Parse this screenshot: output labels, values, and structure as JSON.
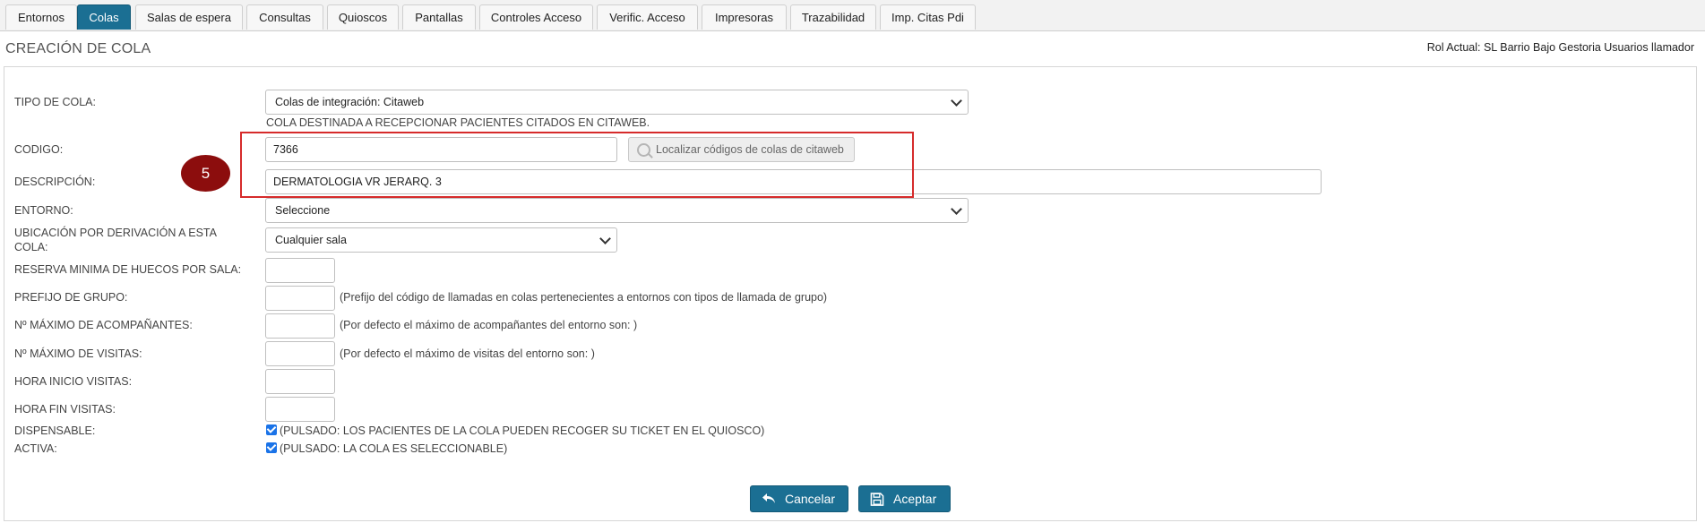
{
  "tabs": [
    {
      "label": "Entornos",
      "active": false
    },
    {
      "label": "Colas",
      "active": true
    },
    {
      "label": "Salas de espera",
      "active": false
    },
    {
      "label": "Consultas",
      "active": false
    },
    {
      "label": "Quioscos",
      "active": false
    },
    {
      "label": "Pantallas",
      "active": false
    },
    {
      "label": "Controles Acceso",
      "active": false
    },
    {
      "label": "Verific. Acceso",
      "active": false
    },
    {
      "label": "Impresoras",
      "active": false
    },
    {
      "label": "Trazabilidad",
      "active": false
    },
    {
      "label": "Imp. Citas Pdi",
      "active": false
    }
  ],
  "header": {
    "title": "CREACIÓN DE COLA",
    "role": "Rol Actual: SL Barrio Bajo Gestoria Usuarios llamador"
  },
  "form": {
    "tipo_label": "TIPO DE COLA:",
    "tipo_value": "Colas de integración: Citaweb",
    "tipo_desc": "COLA DESTINADA A RECEPCIONAR PACIENTES CITADOS EN CITAWEB.",
    "codigo_label": "CODIGO:",
    "codigo_value": "7366",
    "locate_label": "Localizar códigos de colas de citaweb",
    "descripcion_label": "DESCRIPCIÓN:",
    "descripcion_value": "DERMATOLOGIA VR JERARQ. 3",
    "entorno_label": "ENTORNO:",
    "entorno_value": "Seleccione",
    "ubicacion_label_1": "UBICACIÓN POR DERIVACIÓN A ESTA",
    "ubicacion_label_2": "COLA:",
    "ubicacion_value": "Cualquier sala",
    "reserva_label": "RESERVA MINIMA DE HUECOS POR SALA:",
    "prefijo_label": "PREFIJO DE GRUPO:",
    "prefijo_hint": "(Prefijo del código de llamadas en colas pertenecientes a entornos con tipos de llamada de grupo)",
    "acompanantes_label": "Nº MÁXIMO DE ACOMPAÑANTES:",
    "acompanantes_hint": "(Por defecto el máximo de acompañantes del entorno son: )",
    "visitas_label": "Nº MÁXIMO DE VISITAS:",
    "visitas_hint": "(Por defecto el máximo de visitas del entorno son: )",
    "hora_inicio_label": "HORA INICIO VISITAS:",
    "hora_fin_label": "HORA FIN VISITAS:",
    "dispensable_label": "DISPENSABLE:",
    "dispensable_hint": "(PULSADO: LOS PACIENTES DE LA COLA PUEDEN RECOGER SU TICKET EN EL QUIOSCO)",
    "activa_label": "ACTIVA:",
    "activa_hint": "(PULSADO: LA COLA ES SELECCIONABLE)"
  },
  "annotation": {
    "step": "5"
  },
  "buttons": {
    "cancel": "Cancelar",
    "accept": "Aceptar"
  },
  "colors": {
    "accent": "#1b6f93",
    "highlight": "#d62b2b",
    "badge": "#8c0d0d"
  }
}
